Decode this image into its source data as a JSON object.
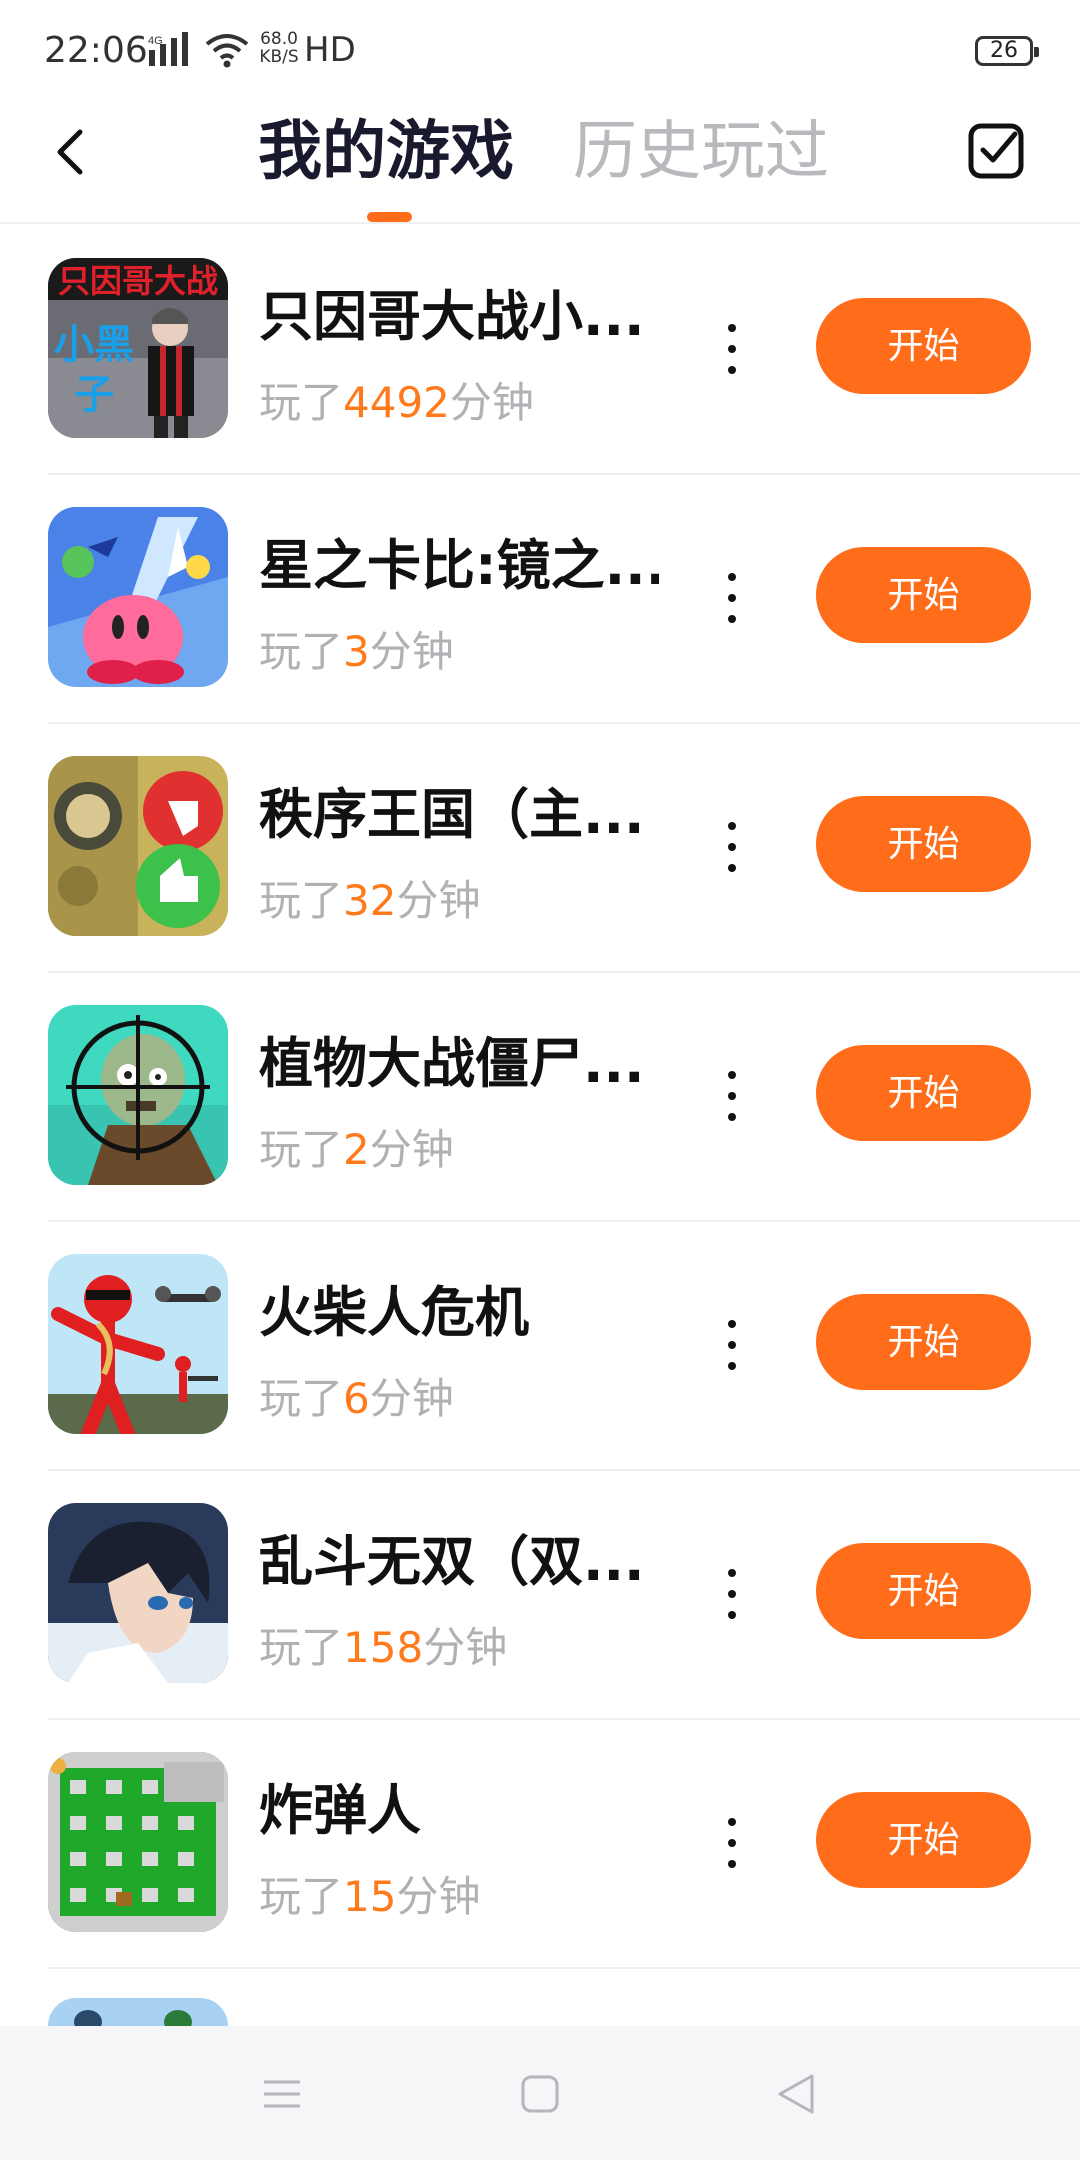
{
  "status_bar": {
    "time": "22:06",
    "speed_value": "68.0",
    "speed_unit": "KB/S",
    "network": "4G",
    "hd": "HD",
    "battery": "26"
  },
  "header": {
    "tabs": [
      {
        "label": "我的游戏",
        "active": true
      },
      {
        "label": "历史玩过",
        "active": false
      }
    ],
    "accent_color": "#ff6d1a"
  },
  "games": [
    {
      "title": "只因哥大战小...",
      "played_prefix": "玩了",
      "minutes": "4492",
      "played_suffix": "分钟",
      "start_label": "开始",
      "icon": "chicken-brother-icon"
    },
    {
      "title": "星之卡比:镜之...",
      "played_prefix": "玩了",
      "minutes": "3",
      "played_suffix": "分钟",
      "start_label": "开始",
      "icon": "kirby-icon"
    },
    {
      "title": "秩序王国（主...",
      "played_prefix": "玩了",
      "minutes": "32",
      "played_suffix": "分钟",
      "start_label": "开始",
      "icon": "thumbs-icon"
    },
    {
      "title": "植物大战僵尸...",
      "played_prefix": "玩了",
      "minutes": "2",
      "played_suffix": "分钟",
      "start_label": "开始",
      "icon": "zombie-crosshair-icon"
    },
    {
      "title": "火柴人危机",
      "played_prefix": "玩了",
      "minutes": "6",
      "played_suffix": "分钟",
      "start_label": "开始",
      "icon": "stickman-icon"
    },
    {
      "title": "乱斗无双（双...",
      "played_prefix": "玩了",
      "minutes": "158",
      "played_suffix": "分钟",
      "start_label": "开始",
      "icon": "anime-hero-icon"
    },
    {
      "title": "炸弹人",
      "played_prefix": "玩了",
      "minutes": "15",
      "played_suffix": "分钟",
      "start_label": "开始",
      "icon": "bomberman-icon"
    }
  ],
  "icon1_text": {
    "top": "只因哥大战",
    "side1": "小黑",
    "side2": "子"
  },
  "nav": {
    "items": [
      "menu-icon",
      "home-square-icon",
      "back-triangle-icon"
    ]
  }
}
